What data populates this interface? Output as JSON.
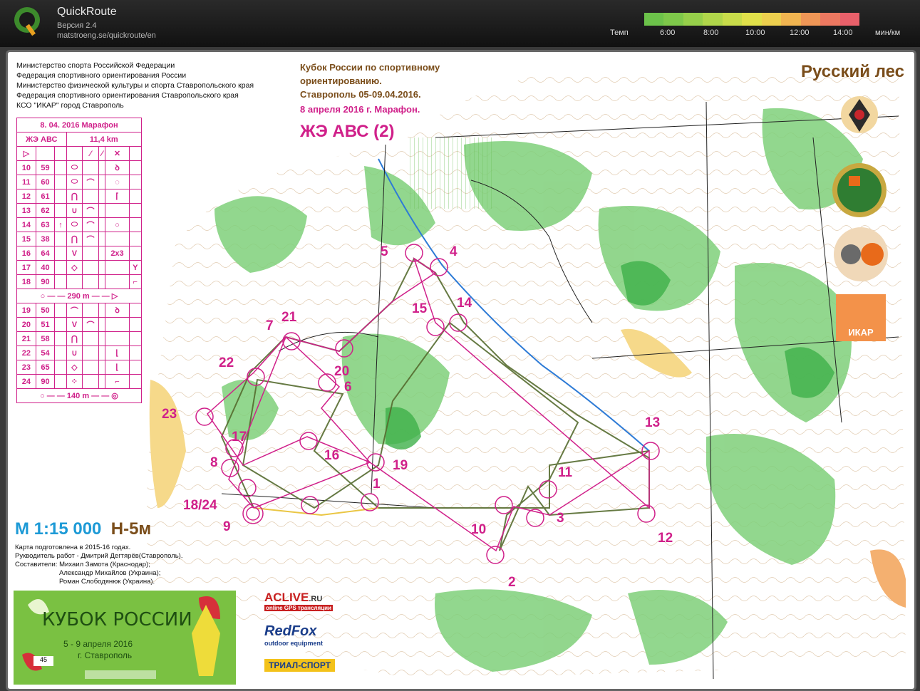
{
  "app": {
    "title": "QuickRoute",
    "version": "Версия 2.4",
    "url": "matstroeng.se/quickroute/en"
  },
  "pace_scale": {
    "label": "Темп",
    "ticks": [
      "6:00",
      "8:00",
      "10:00",
      "12:00",
      "14:00"
    ],
    "unit": "мин/км",
    "colors": [
      "#6cc24a",
      "#a6d24a",
      "#e6e04a",
      "#f0a050",
      "#e8506a"
    ]
  },
  "map": {
    "org_lines": [
      "Министерство спорта Российской Федерации",
      "Федерация спортивного ориентирования России",
      "Министерство физической культуры и спорта Ставропольского края",
      "Федерация спортивного ориентирования Ставропольского края",
      "КСО \"ИКАР\" город Ставрополь"
    ],
    "cup_title": [
      "Кубок России по спортивному",
      "ориентированию.",
      "Ставрополь 05-09.04.2016."
    ],
    "cup_date": "8 апреля 2016 г. Марафон.",
    "course_name": "ЖЭ АВС (2)",
    "area_name": "Русский лес",
    "scale": "М 1:15 000",
    "contour": "Н-5м",
    "credits": [
      "Карта подготовлена в 2015-16 годах.",
      "Рукводитель работ - Дмитрий Дегтярёв(Ставрополь).",
      "Составители: Михаил Замота (Краснодар);",
      "Александр Михайлов (Украина);",
      "Роман Слободянюк (Украина)."
    ],
    "banner": {
      "title": "КУБОК РОССИИ",
      "dates": "5 - 9 апреля 2016",
      "city": "г. Ставрополь",
      "badge": "45"
    },
    "sponsors": {
      "aclive": "ACLIVE",
      "aclive_tld": ".RU",
      "aclive_sub": "online GPS трансляции",
      "redfox": "RedFox",
      "redfox_sub": "outdoor equipment",
      "trial": "ТРИАЛ-СПОРТ"
    }
  },
  "control_descriptions": {
    "header_date": "8. 04. 2016   Марафон",
    "class": "ЖЭ АВС",
    "length": "11,4 km",
    "rows1": [
      [
        "10",
        "59"
      ],
      [
        "11",
        "60"
      ],
      [
        "12",
        "61"
      ],
      [
        "13",
        "62"
      ],
      [
        "14",
        "63"
      ],
      [
        "15",
        "38"
      ],
      [
        "16",
        "64"
      ],
      [
        "17",
        "40"
      ],
      [
        "18",
        "90"
      ]
    ],
    "marked_route_1": "290 m",
    "rows2": [
      [
        "19",
        "50"
      ],
      [
        "20",
        "51"
      ],
      [
        "21",
        "58"
      ],
      [
        "22",
        "54"
      ],
      [
        "23",
        "65"
      ],
      [
        "24",
        "90"
      ]
    ],
    "marked_route_2": "140 m",
    "extra_2x3": "2x3"
  },
  "controls": [
    {
      "n": "5"
    },
    {
      "n": "4"
    },
    {
      "n": "15"
    },
    {
      "n": "14"
    },
    {
      "n": "7"
    },
    {
      "n": "21"
    },
    {
      "n": "22"
    },
    {
      "n": "20"
    },
    {
      "n": "6"
    },
    {
      "n": "23"
    },
    {
      "n": "17"
    },
    {
      "n": "16"
    },
    {
      "n": "19"
    },
    {
      "n": "8"
    },
    {
      "n": "1"
    },
    {
      "n": "18/24"
    },
    {
      "n": "9"
    },
    {
      "n": "10"
    },
    {
      "n": "2"
    },
    {
      "n": "3"
    },
    {
      "n": "11"
    },
    {
      "n": "13"
    },
    {
      "n": "12"
    }
  ]
}
